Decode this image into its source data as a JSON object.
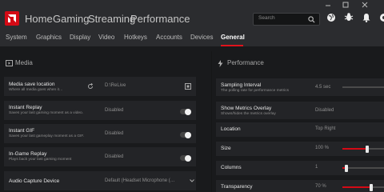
{
  "topnav": {
    "items": [
      "Home",
      "Gaming",
      "Streaming",
      "Performance"
    ],
    "search_placeholder": "Search"
  },
  "subnav": {
    "items": [
      "System",
      "Graphics",
      "Display",
      "Video",
      "Hotkeys",
      "Accounts",
      "Devices",
      "General"
    ],
    "active": "General"
  },
  "media": {
    "heading": "Media",
    "rows": [
      {
        "title": "Media save location",
        "desc": "Where all media goes when it…",
        "value": "D:\\ReLive"
      },
      {
        "title": "Instant Replay",
        "desc": "Saves your last gaming moment as a video.",
        "value": "Disabled"
      },
      {
        "title": "Instant GIF",
        "desc": "Saves your last gameplay moment as a GIF.",
        "value": "Disabled"
      },
      {
        "title": "In-Game Replay",
        "desc": "Plays back your last gaming moment",
        "value": "Disabled"
      },
      {
        "title": "Audio Capture Device",
        "desc": "",
        "value": "Default (Headset Microphone (…"
      }
    ]
  },
  "performance": {
    "heading": "Performance",
    "rows": [
      {
        "title": "Sampling Interval",
        "desc": "The polling rate for performance metrics",
        "value": "4.5 sec",
        "level": 0.45
      },
      {
        "title": "Show Metrics Overlay",
        "desc": "Shows/hides the metrics overlay",
        "value": "Disabled"
      },
      {
        "title": "Location",
        "desc": "",
        "value": "Top Right"
      },
      {
        "title": "Size",
        "desc": "",
        "value": "100 %",
        "level": 0.6
      },
      {
        "title": "Columns",
        "desc": "",
        "value": "1",
        "level": 0.1
      },
      {
        "title": "Transparency",
        "desc": "",
        "value": "70 %",
        "level": 0.7
      }
    ]
  },
  "colors": {
    "accent": "#d40a15",
    "background": "#191a1c",
    "panel": "#232427",
    "topbar": "#2b2c2f"
  }
}
